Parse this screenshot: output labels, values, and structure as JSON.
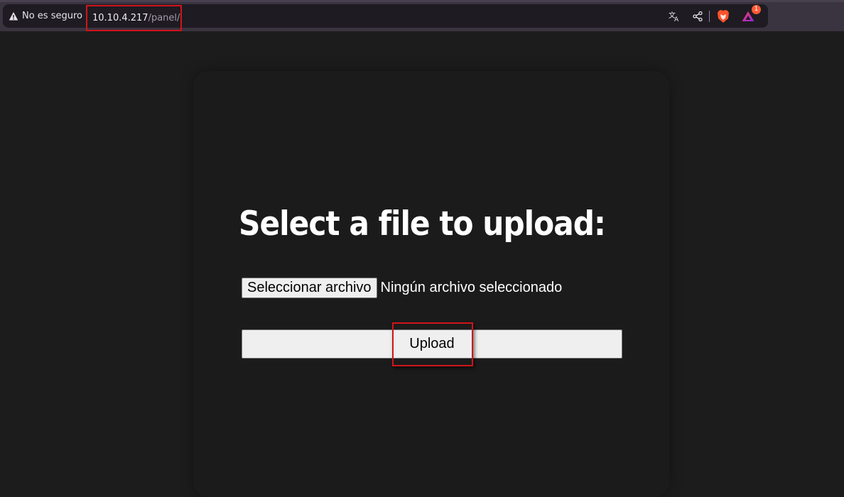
{
  "browser": {
    "security_label": "No es seguro",
    "url_host": "10.10.4.217",
    "url_path": "/panel/",
    "notification_count": "1",
    "icons": [
      "warning-icon",
      "translate-icon",
      "share-icon",
      "brave-lion-icon",
      "rewards-triangle-icon"
    ]
  },
  "page": {
    "heading": "Select a file to upload:",
    "file_input": {
      "button_label": "Seleccionar archivo",
      "status_text": "Ningún archivo seleccionado"
    },
    "upload_label": "Upload"
  },
  "colors": {
    "highlight_border": "#d0141a",
    "page_background": "#1c1c1c",
    "toolbar_background": "#3a3340"
  }
}
